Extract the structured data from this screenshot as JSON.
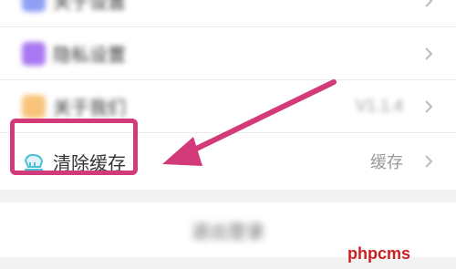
{
  "settings_list": {
    "rows": [
      {
        "label": "关于设置",
        "value": "",
        "icon": "settings-icon",
        "icon_color": "#7b8cf0"
      },
      {
        "label": "隐私设置",
        "value": "",
        "icon": "puzzle-icon",
        "icon_color": "#a06df0"
      },
      {
        "label": "关于我们",
        "value": "V1.1.4",
        "icon": "info-icon",
        "icon_color": "#f6b44e"
      },
      {
        "label": "清除缓存",
        "value": "缓存",
        "icon": "broom-icon",
        "icon_color": "#4bbfd6"
      }
    ]
  },
  "bottom_button": {
    "label": "退出登录"
  },
  "annotation": {
    "highlight_color": "#d23a79"
  },
  "watermark": {
    "text": "phpcms"
  }
}
